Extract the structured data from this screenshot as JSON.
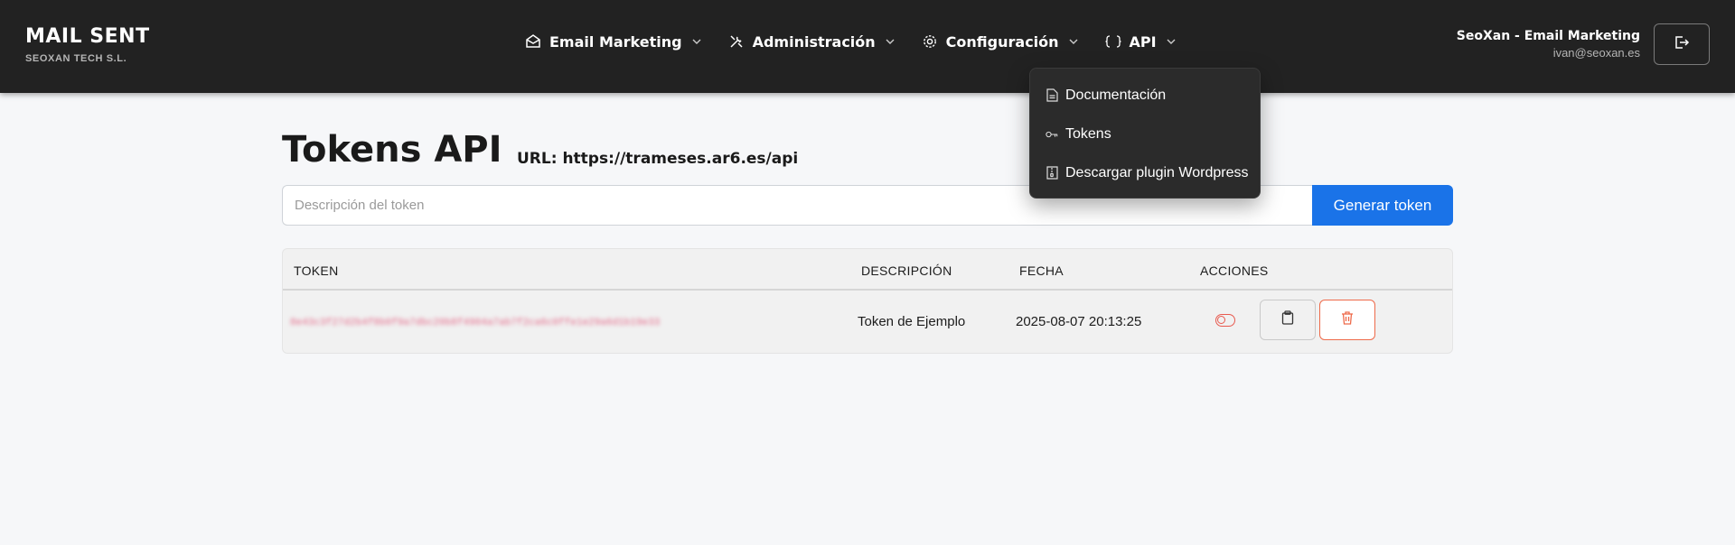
{
  "brand": {
    "title": "MAIL SENT",
    "subtitle": "SEOXAN TECH S.L."
  },
  "nav": [
    {
      "label": "Email Marketing",
      "icon": "envelope-icon"
    },
    {
      "label": "Administración",
      "icon": "tools-icon"
    },
    {
      "label": "Configuración",
      "icon": "gear-icon"
    },
    {
      "label": "API",
      "icon": "braces-icon"
    }
  ],
  "api_menu": [
    {
      "label": "Documentación",
      "icon": "document-icon"
    },
    {
      "label": "Tokens",
      "icon": "key-icon"
    },
    {
      "label": "Descargar plugin Wordpress",
      "icon": "file-zip-icon"
    }
  ],
  "user": {
    "name": "SeoXan - Email Marketing",
    "email": "ivan@seoxan.es"
  },
  "page": {
    "title": "Tokens API",
    "url": "URL: https://trameses.ar6.es/api"
  },
  "form": {
    "placeholder": "Descripción del token",
    "button": "Generar token"
  },
  "table": {
    "headers": [
      "TOKEN",
      "DESCRIPCIÓN",
      "FECHA",
      "ACCIONES"
    ],
    "rows": [
      {
        "token": "8e43c3f27d2b4f8b0f9a7dbc20b8f4904a7ab7f2ca6c0ffe1e29a6d1b19e33",
        "description": "Token de Ejemplo",
        "date": "2025-08-07 20:13:25"
      }
    ]
  },
  "colors": {
    "header_bg": "#222222",
    "primary": "#1a73e8",
    "danger": "#ee6a4a"
  }
}
